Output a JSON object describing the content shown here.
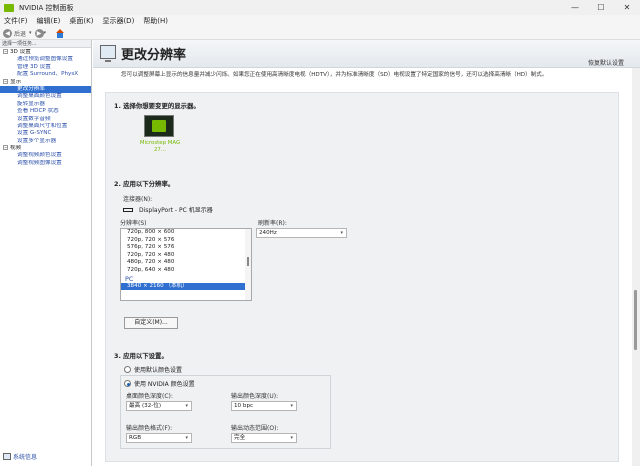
{
  "window": {
    "title": "NVIDIA 控制面板",
    "min": "—",
    "max": "☐",
    "close": "✕"
  },
  "menu": [
    "文件(F)",
    "编辑(E)",
    "桌面(K)",
    "显示器(D)",
    "帮助(H)"
  ],
  "toolbar": {
    "back_label": "后退",
    "back_glyph": "◀",
    "forward_glyph": "▶",
    "drop_glyph": "▾"
  },
  "sidebar": {
    "header": "选择一项任务...",
    "tree": [
      {
        "type": "cat",
        "label": "3D 设置",
        "expand": "−"
      },
      {
        "type": "leaf",
        "label": "通过预览调整图像设置"
      },
      {
        "type": "leaf",
        "label": "管理 3D 设置"
      },
      {
        "type": "leaf",
        "label": "配置 Surround、PhysX"
      },
      {
        "type": "cat",
        "label": "显示",
        "expand": "−"
      },
      {
        "type": "leaf",
        "label": "更改分辨率",
        "selected": true
      },
      {
        "type": "leaf",
        "label": "调整桌面颜色设置"
      },
      {
        "type": "leaf",
        "label": "旋转显示器"
      },
      {
        "type": "leaf",
        "label": "查看 HDCP 状态"
      },
      {
        "type": "leaf",
        "label": "设置数字音频"
      },
      {
        "type": "leaf",
        "label": "调整桌面尺寸和位置"
      },
      {
        "type": "leaf",
        "label": "设置 G-SYNC"
      },
      {
        "type": "leaf",
        "label": "设置多个显示器"
      },
      {
        "type": "cat",
        "label": "视频",
        "expand": "−"
      },
      {
        "type": "leaf",
        "label": "调整视频颜色设置"
      },
      {
        "type": "leaf",
        "label": "调整视频图像设置"
      }
    ],
    "system_info": "系统信息"
  },
  "page": {
    "title": "更改分辨率",
    "restore_defaults": "恢复默认设置",
    "description": "您可以调整屏幕上显示的信息量并减少闪烁。如果您正在使用高清晰度电视（HDTV），并为标准清晰度（SD）电视设置了特定国家的信号，还可以选择高清晰（HD）制式。"
  },
  "step1": {
    "title": "1. 选择你想要变更的显示器。",
    "monitor_label": "Microstep MAG 27..."
  },
  "step2": {
    "title": "2. 应用以下分辨率。",
    "connector_label": "连接器(N):",
    "connector_value": "DisplayPort - PC 机显示器",
    "resolution_label": "分辨率(S)",
    "resolutions": [
      "720p, 800 × 600",
      "720p, 720 × 576",
      "576p, 720 × 576",
      "720p, 720 × 480",
      "480p, 720 × 480",
      "720p, 640 × 480"
    ],
    "group_label": "PC",
    "selected_resolution": "3840 × 2160 （本机）",
    "refresh_label": "刷新率(R):",
    "refresh_value": "240Hz",
    "custom_button": "自定义(M)..."
  },
  "step3": {
    "title": "3. 应用以下设置。",
    "radio_default": "使用默认颜色设置",
    "radio_nvidia": "使用 NVIDIA 颜色设置",
    "desktop_depth_label": "桌面颜色深度(C):",
    "desktop_depth_value": "最高 (32-位)",
    "output_depth_label": "输出颜色深度(U):",
    "output_depth_value": "10 bpc",
    "output_format_label": "输出颜色格式(F):",
    "output_format_value": "RGB",
    "dynamic_range_label": "输出动态范围(O):",
    "dynamic_range_value": "完全"
  }
}
